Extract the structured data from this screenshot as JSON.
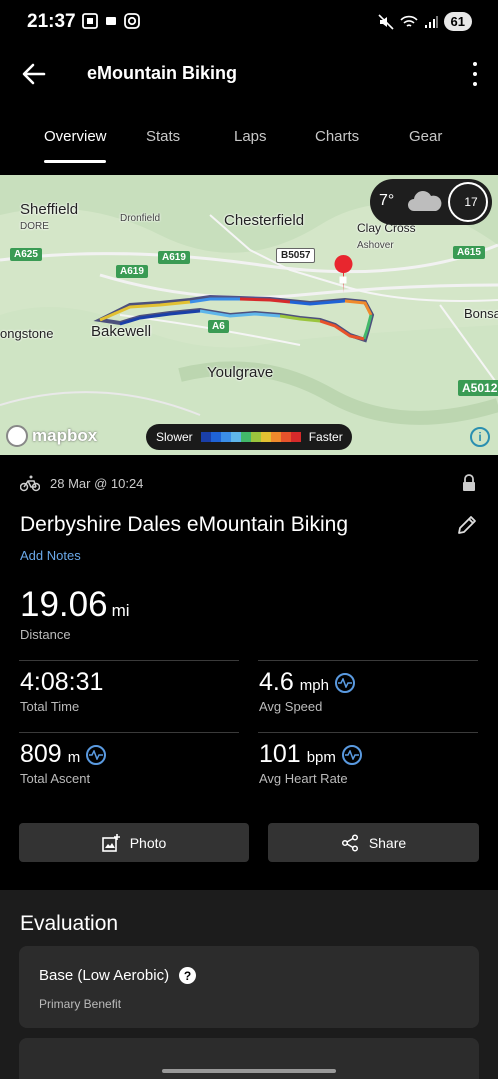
{
  "status_bar": {
    "time": "21:37",
    "battery": "61"
  },
  "app_bar": {
    "title": "eMountain Biking"
  },
  "tabs": [
    {
      "label": "Overview",
      "active": true
    },
    {
      "label": "Stats",
      "active": false
    },
    {
      "label": "Laps",
      "active": false
    },
    {
      "label": "Charts",
      "active": false
    },
    {
      "label": "Gear",
      "active": false
    }
  ],
  "map": {
    "places": {
      "sheffield": "Sheffield",
      "dore": "DORE",
      "dronfield": "Dronfield",
      "chesterfield": "Chesterfield",
      "clay_cross": "Clay Cross",
      "ashover": "Ashover",
      "bonsall": "Bonsa",
      "longstone": "ongstone",
      "bakewell": "Bakewell",
      "youlgrave": "Youlgrave"
    },
    "roads": {
      "a625": "A625",
      "a619a": "A619",
      "a619b": "A619",
      "b5057": "B5057",
      "a615": "A615",
      "a6": "A6",
      "a5012": "A5012"
    },
    "weather": {
      "temperature": "7°",
      "wind": "17",
      "icon": "cloud-icon"
    },
    "provider": "mapbox",
    "legend": {
      "slower": "Slower",
      "faster": "Faster",
      "colors": [
        "#1a3fa8",
        "#1f63d6",
        "#3b8ee8",
        "#5fb6ea",
        "#42b86a",
        "#9bc53d",
        "#e2c132",
        "#f08a2c",
        "#e8532b",
        "#d62a2a"
      ]
    }
  },
  "activity": {
    "date": "28 Mar @ 10:24",
    "title": "Derbyshire Dales eMountain Biking",
    "add_notes": "Add Notes",
    "distance": {
      "value": "19.06",
      "unit": "mi",
      "label": "Distance"
    },
    "total_time": {
      "value": "4:08:31",
      "label": "Total Time"
    },
    "avg_speed": {
      "value": "4.6",
      "unit": "mph",
      "label": "Avg Speed"
    },
    "total_ascent": {
      "value": "809",
      "unit": "m",
      "label": "Total Ascent"
    },
    "avg_hr": {
      "value": "101",
      "unit": "bpm",
      "label": "Avg Heart Rate"
    }
  },
  "actions": {
    "photo": "Photo",
    "share": "Share"
  },
  "evaluation": {
    "heading": "Evaluation",
    "benefit": "Base (Low Aerobic)",
    "benefit_label": "Primary Benefit"
  }
}
